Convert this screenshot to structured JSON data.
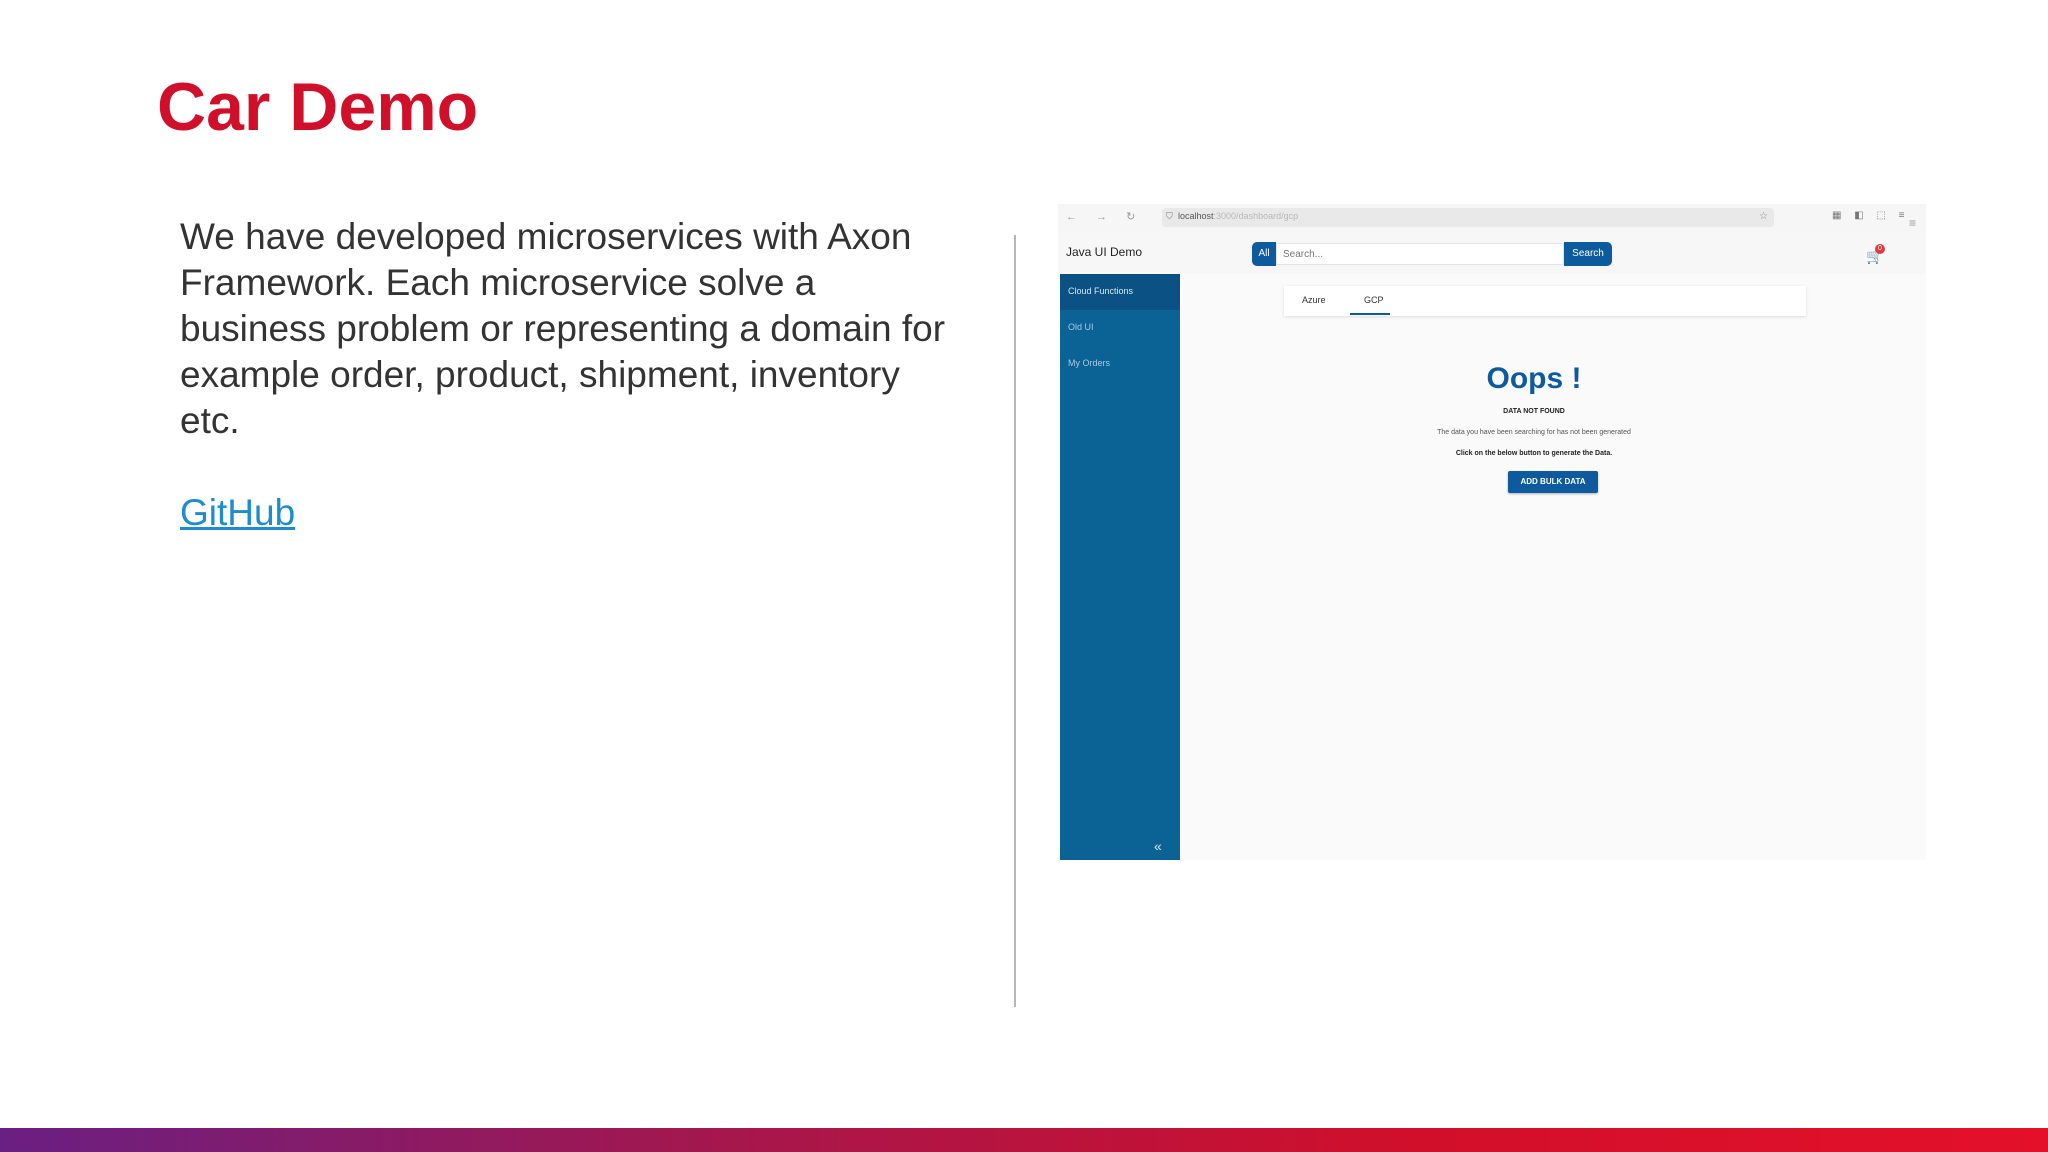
{
  "slide": {
    "title": "Car Demo",
    "body": "We have developed microservices with Axon Framework. Each microservice solve a business problem or representing a domain for example order, product, shipment, inventory etc.",
    "link_label": "GitHub"
  },
  "screenshot": {
    "browser": {
      "nav": "← → ↻",
      "url_host": "localhost",
      "url_path": ":3000/dashboard/gcp",
      "icons": "▦ ◧ ⬚ ≡",
      "menu": "≡"
    },
    "app": {
      "brand": "Java UI Demo",
      "search_category": "All",
      "search_placeholder": "Search...",
      "search_button": "Search",
      "cart_count": "0"
    },
    "sidebar": {
      "items": [
        "Cloud Functions",
        "Old UI",
        "My Orders"
      ],
      "active_index": 0,
      "collapse_glyph": "«"
    },
    "tabs": [
      "Azure",
      "GCP"
    ],
    "active_tab": 1,
    "empty_state": {
      "title": "Oops !",
      "subtitle": "DATA NOT FOUND",
      "description": "The data you have been searching for has not been generated",
      "instruction": "Click on the below button to generate the Data.",
      "button": "ADD BULK DATA"
    }
  },
  "colors": {
    "title_red": "#d0102a",
    "link_blue": "#1b8ccf",
    "app_primary": "#0d5b9e",
    "sidebar": "#0a6295"
  }
}
